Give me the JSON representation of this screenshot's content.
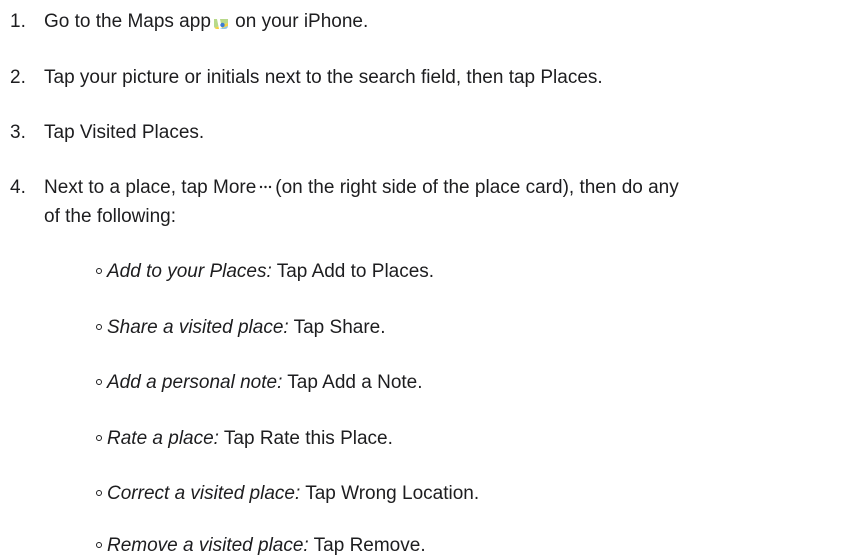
{
  "steps": [
    {
      "number": "1.",
      "before_icon": "Go to the Maps app",
      "icon": "maps-app-icon",
      "after_icon": "on your iPhone."
    },
    {
      "number": "2.",
      "text": "Tap your picture or initials next to the search field, then tap Places."
    },
    {
      "number": "3.",
      "text": "Tap Visited Places."
    },
    {
      "number": "4.",
      "before_icon": "Next to a place, tap More",
      "icon": "more-ellipsis-icon",
      "after_icon": "(on the right side of the place card), then do any",
      "line2": "of the following:"
    }
  ],
  "substeps": [
    {
      "label": "Add to your Places:",
      "text": "Tap Add to Places."
    },
    {
      "label": "Share a visited place:",
      "text": "Tap Share."
    },
    {
      "label": "Add a personal note:",
      "text": "Tap Add a Note."
    },
    {
      "label": "Rate a place:",
      "text": "Tap Rate this Place."
    },
    {
      "label": "Correct a visited place:",
      "text": "Tap Wrong Location."
    },
    {
      "label": "Remove a visited place:",
      "text": "Tap Remove."
    }
  ]
}
